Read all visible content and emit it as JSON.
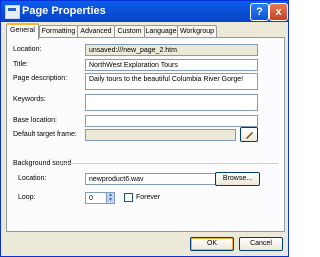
{
  "window": {
    "title": "Page Properties",
    "help_glyph": "?",
    "close_glyph": "x"
  },
  "tabs": [
    "General",
    "Formatting",
    "Advanced",
    "Custom",
    "Language",
    "Workgroup"
  ],
  "general": {
    "location_label": "Location:",
    "location_value": "unsaved:///new_page_2.htm",
    "title_label": "Title:",
    "title_value": "NorthWest Exploration Tours",
    "description_label": "Page description:",
    "description_value": "Daily tours to the beautiful Columbia River Gorge!",
    "keywords_label": "Keywords:",
    "keywords_value": "",
    "base_location_label": "Base location:",
    "base_location_value": "",
    "target_frame_label": "Default target frame:",
    "target_frame_value": "",
    "target_frame_icon": "pencil-icon"
  },
  "background_sound": {
    "section_label": "Background sound",
    "location_label": "Location:",
    "location_value": "newproduct6.wav",
    "browse_label": "Browse...",
    "loop_label": "Loop:",
    "loop_value": "0",
    "forever_label": "Forever",
    "forever_checked": false
  },
  "footer": {
    "ok_label": "OK",
    "cancel_label": "Cancel"
  },
  "colors": {
    "titlebar": "#0a4fd6",
    "dialog_bg": "#ece9d8",
    "active_tab_accent": "#f9b437"
  }
}
